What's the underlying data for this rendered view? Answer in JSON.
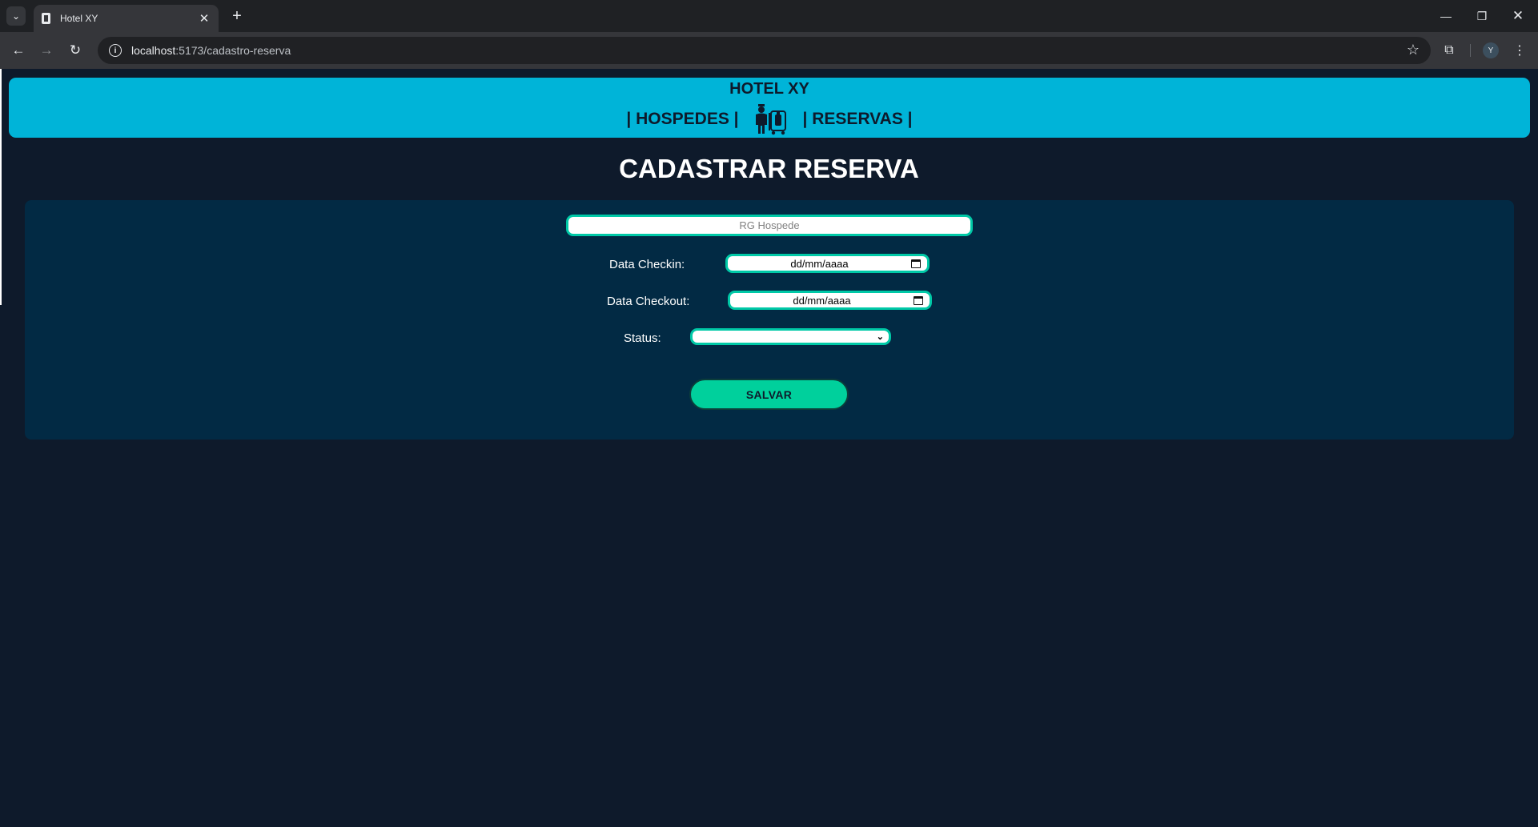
{
  "browser": {
    "tab_title": "Hotel XY",
    "tab_close": "✕",
    "new_tab": "+",
    "url_host": "localhost",
    "url_path": ":5173/cadastro-reserva",
    "avatar_initial": "Y",
    "icons": [
      "tab-search-icon",
      "hotel-favicon-icon",
      "back-icon",
      "forward-icon",
      "reload-icon",
      "info-icon",
      "star-icon",
      "extensions-icon",
      "menu-icon",
      "minimize-icon",
      "restore-icon",
      "close-window-icon"
    ]
  },
  "header": {
    "brand": "HOTEL XY",
    "nav_left": "| HOSPEDES |",
    "nav_right": "| RESERVAS |",
    "logo_icon": "bellhop-luggage-icon"
  },
  "page": {
    "title": "CADASTRAR RESERVA"
  },
  "form": {
    "rg_placeholder": "RG Hospede",
    "rg_value": "",
    "checkin_label": "Data Checkin:",
    "checkin_value": "dd/mm/aaaa",
    "checkout_label": "Data Checkout:",
    "checkout_value": "dd/mm/aaaa",
    "status_label": "Status:",
    "status_value": "",
    "save_label": "SALVAR"
  },
  "colors": {
    "header_bg": "#00b4d8",
    "page_bg": "#0e1a2b",
    "card_bg": "#022a44",
    "accent_border": "#00c9a7",
    "button_bg": "#00d09c"
  }
}
